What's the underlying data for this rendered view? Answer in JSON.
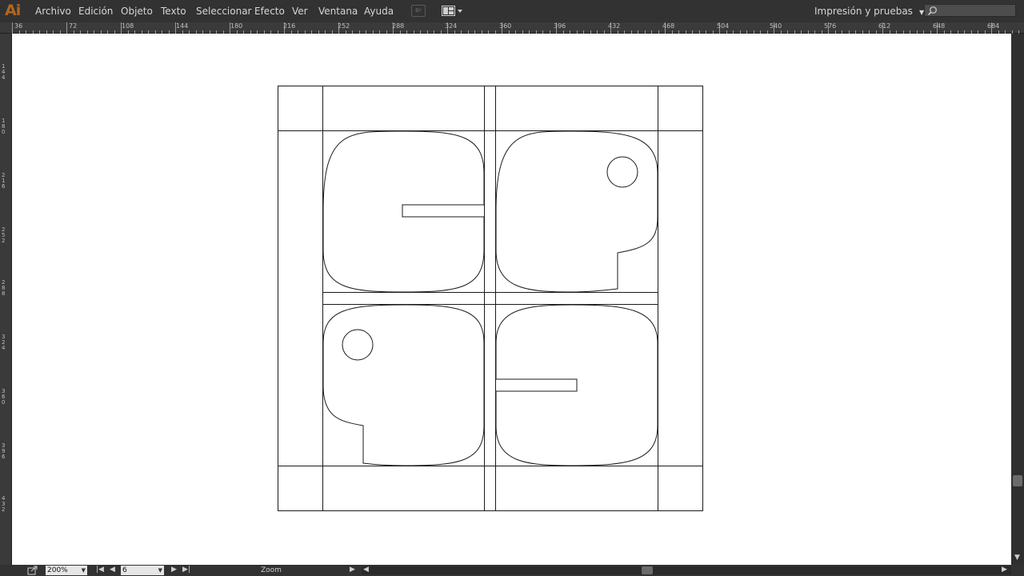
{
  "app": {
    "logo": "Ai"
  },
  "menu": {
    "items": [
      "Archivo",
      "Edición",
      "Objeto",
      "Texto",
      "Seleccionar",
      "Efecto",
      "Ver",
      "Ventana",
      "Ayuda"
    ],
    "bridge_label": "Br"
  },
  "workspace": {
    "label": "Impresión y pruebas"
  },
  "search": {
    "placeholder": ""
  },
  "ruler_top": [
    "36",
    "72",
    "108",
    "144",
    "180",
    "216",
    "252",
    "288",
    "324",
    "360",
    "396",
    "432",
    "468",
    "504",
    "540",
    "576",
    "612",
    "648",
    "684"
  ],
  "ruler_left": [
    "144",
    "180",
    "216",
    "252",
    "288",
    "324",
    "360",
    "396",
    "432"
  ],
  "status": {
    "zoom": "200%",
    "artboard": "6",
    "mode_text": "Zoom"
  },
  "colors": {
    "accent": "#b3651f",
    "stroke": "#1a1a1a"
  }
}
